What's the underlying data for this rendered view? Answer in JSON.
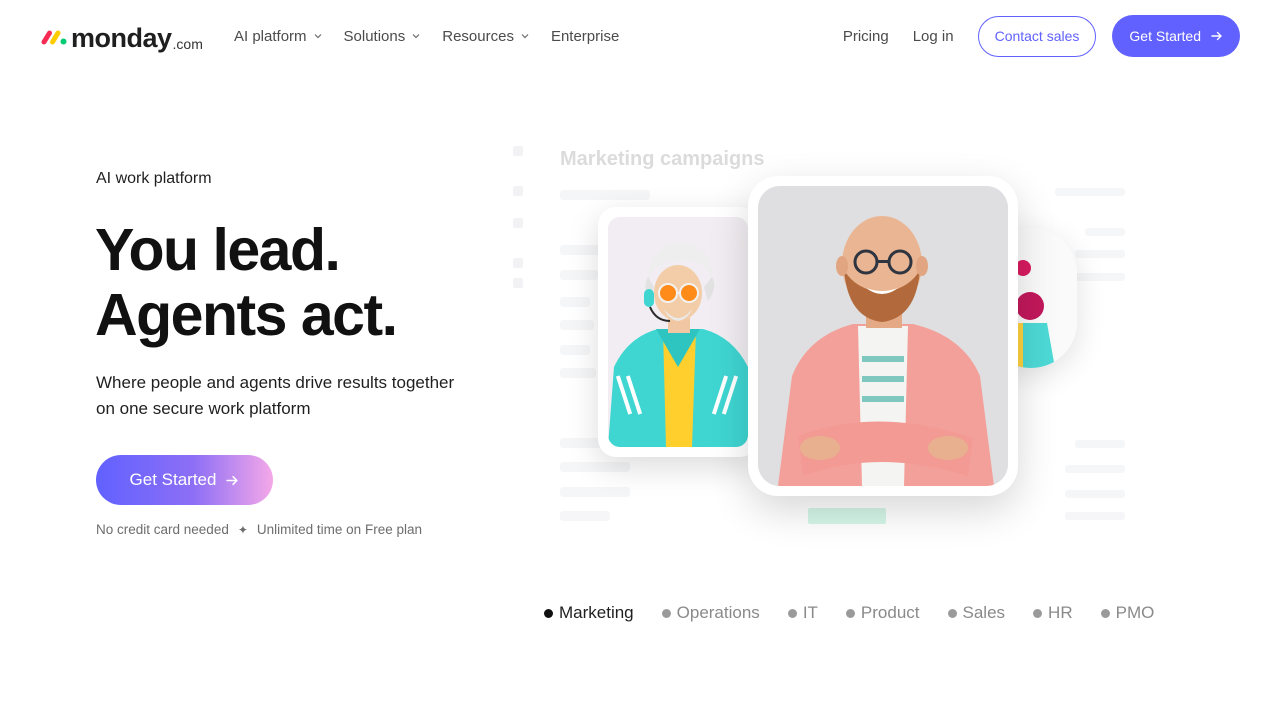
{
  "header": {
    "logo": {
      "word": "monday",
      "suffix": ".com"
    },
    "nav": [
      {
        "label": "AI platform",
        "has_menu": true
      },
      {
        "label": "Solutions",
        "has_menu": true
      },
      {
        "label": "Resources",
        "has_menu": true
      },
      {
        "label": "Enterprise",
        "has_menu": false
      }
    ],
    "pricing_label": "Pricing",
    "login_label": "Log in",
    "contact_label": "Contact sales",
    "get_started_label": "Get Started"
  },
  "hero": {
    "eyebrow": "AI work platform",
    "headline_line1": "You lead.",
    "headline_line2": "Agents act.",
    "subtext": "Where people and agents drive results together on one secure work platform",
    "cta_label": "Get Started",
    "note_left": "No credit card needed",
    "note_right": "Unlimited time on Free plan"
  },
  "board": {
    "title": "Marketing campaigns"
  },
  "tabs": [
    {
      "label": "Marketing",
      "active": true
    },
    {
      "label": "Operations",
      "active": false
    },
    {
      "label": "IT",
      "active": false
    },
    {
      "label": "Product",
      "active": false
    },
    {
      "label": "Sales",
      "active": false
    },
    {
      "label": "HR",
      "active": false
    },
    {
      "label": "PMO",
      "active": false
    }
  ],
  "colors": {
    "primary": "#6161ff",
    "text": "#1f1f1f",
    "muted": "#6d6d6d",
    "status_green": "#00c875"
  },
  "icons": {
    "nav_chevron": "chevron-down-icon",
    "button_arrow": "arrow-right-icon",
    "note_separator": "sparkle-icon"
  }
}
